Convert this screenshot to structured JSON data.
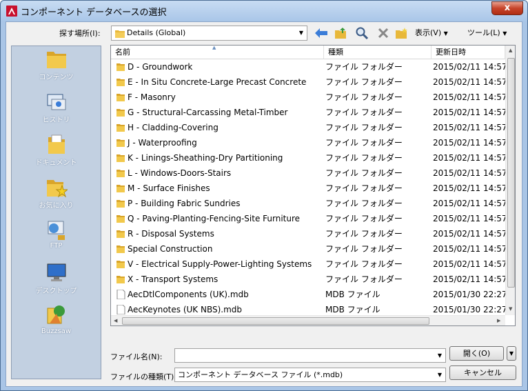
{
  "window": {
    "title": "コンポーネント データベースの選択",
    "close_label": "x"
  },
  "toolbar": {
    "lookin_label": "探す場所(I):",
    "lookin_value": "Details (Global)",
    "view_menu": "表示(V)",
    "tools_menu": "ツール(L)"
  },
  "places": [
    {
      "label": "コンテンツ",
      "icon": "folder-icon"
    },
    {
      "label": "ヒストリ",
      "icon": "history-icon"
    },
    {
      "label": "ドキュメント",
      "icon": "documents-icon"
    },
    {
      "label": "お気に入り",
      "icon": "favorites-icon"
    },
    {
      "label": "FTP",
      "icon": "ftp-icon"
    },
    {
      "label": "デスクトップ",
      "icon": "desktop-icon"
    },
    {
      "label": "Buzzsaw",
      "icon": "buzzsaw-icon"
    }
  ],
  "list": {
    "headers": {
      "name": "名前",
      "type": "種類",
      "date": "更新日時"
    },
    "rows": [
      {
        "name": "D - Groundwork",
        "type": "ファイル フォルダー",
        "date": "2015/02/11 14:57",
        "kind": "folder"
      },
      {
        "name": "E - In Situ Concrete-Large Precast Concrete",
        "type": "ファイル フォルダー",
        "date": "2015/02/11 14:57",
        "kind": "folder"
      },
      {
        "name": "F - Masonry",
        "type": "ファイル フォルダー",
        "date": "2015/02/11 14:57",
        "kind": "folder"
      },
      {
        "name": "G - Structural-Carcassing Metal-Timber",
        "type": "ファイル フォルダー",
        "date": "2015/02/11 14:57",
        "kind": "folder"
      },
      {
        "name": "H - Cladding-Covering",
        "type": "ファイル フォルダー",
        "date": "2015/02/11 14:57",
        "kind": "folder"
      },
      {
        "name": "J - Waterproofing",
        "type": "ファイル フォルダー",
        "date": "2015/02/11 14:57",
        "kind": "folder"
      },
      {
        "name": "K - Linings-Sheathing-Dry Partitioning",
        "type": "ファイル フォルダー",
        "date": "2015/02/11 14:57",
        "kind": "folder"
      },
      {
        "name": "L - Windows-Doors-Stairs",
        "type": "ファイル フォルダー",
        "date": "2015/02/11 14:57",
        "kind": "folder"
      },
      {
        "name": "M - Surface Finishes",
        "type": "ファイル フォルダー",
        "date": "2015/02/11 14:57",
        "kind": "folder"
      },
      {
        "name": "P - Building Fabric Sundries",
        "type": "ファイル フォルダー",
        "date": "2015/02/11 14:57",
        "kind": "folder"
      },
      {
        "name": "Q - Paving-Planting-Fencing-Site Furniture",
        "type": "ファイル フォルダー",
        "date": "2015/02/11 14:57",
        "kind": "folder"
      },
      {
        "name": "R - Disposal Systems",
        "type": "ファイル フォルダー",
        "date": "2015/02/11 14:57",
        "kind": "folder"
      },
      {
        "name": "Special Construction",
        "type": "ファイル フォルダー",
        "date": "2015/02/11 14:57",
        "kind": "folder"
      },
      {
        "name": "V - Electrical Supply-Power-Lighting Systems",
        "type": "ファイル フォルダー",
        "date": "2015/02/11 14:57",
        "kind": "folder"
      },
      {
        "name": "X - Transport Systems",
        "type": "ファイル フォルダー",
        "date": "2015/02/11 14:57",
        "kind": "folder"
      },
      {
        "name": "AecDtlComponents (UK).mdb",
        "type": "MDB ファイル",
        "date": "2015/01/30 22:27",
        "kind": "file"
      },
      {
        "name": "AecKeynotes (UK NBS).mdb",
        "type": "MDB ファイル",
        "date": "2015/01/30 22:27",
        "kind": "file"
      }
    ]
  },
  "footer": {
    "filename_label": "ファイル名(N):",
    "filename_value": "",
    "filetype_label": "ファイルの種類(T):",
    "filetype_value": "コンポーネント データベース ファイル (*.mdb)",
    "open_label": "開く(O)",
    "cancel_label": "キャンセル"
  },
  "colors": {
    "folder": "#e8b83a",
    "accent": "#3b7dd8",
    "close": "#c7442a"
  }
}
